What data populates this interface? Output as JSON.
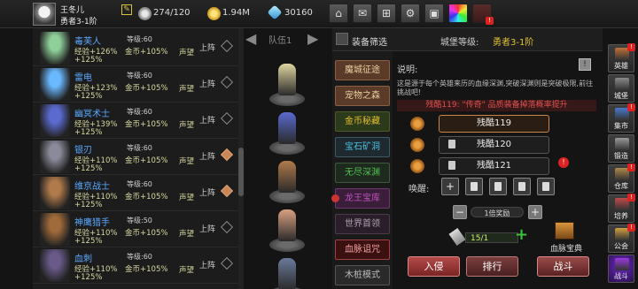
{
  "player": {
    "name": "王冬儿",
    "rank": "勇者3-1阶",
    "stamina": "274/120",
    "gold": "1.94M",
    "gems": "30160"
  },
  "toolbar": {
    "icons": [
      "shop-icon",
      "mail-icon",
      "gamepad-icon",
      "gear-icon",
      "gift-icon",
      "color-wheel-icon",
      "alert-icon"
    ],
    "badge": "!"
  },
  "heroes": [
    {
      "name": "毒芙人",
      "level": "等级:60",
      "exp": "经验+126%",
      "gold": "金币+105%",
      "extra": "+125%",
      "rep": "声望",
      "deploy": "上阵",
      "deployed": false,
      "color": "#8fcf9a"
    },
    {
      "name": "雷电",
      "level": "等级:60",
      "exp": "经验+123%",
      "gold": "金币+105%",
      "extra": "+125%",
      "rep": "声望",
      "deploy": "上阵",
      "deployed": false,
      "color": "#6ab8ff"
    },
    {
      "name": "幽冥术士",
      "level": "等级:60",
      "exp": "经验+139%",
      "gold": "金币+105%",
      "extra": "+125%",
      "rep": "声望",
      "deploy": "上阵",
      "deployed": false,
      "color": "#5a6acf"
    },
    {
      "name": "银刃",
      "level": "等级:60",
      "exp": "经验+110%",
      "gold": "金币+105%",
      "extra": "+125%",
      "rep": "声望",
      "deploy": "上阵",
      "deployed": true,
      "color": "#8a8a9a"
    },
    {
      "name": "维京战士",
      "level": "等级:60",
      "exp": "经验+110%",
      "gold": "金币+105%",
      "extra": "+125%",
      "rep": "声望",
      "deploy": "上阵",
      "deployed": true,
      "color": "#b07a4a"
    },
    {
      "name": "神鹰猎手",
      "level": "等级:50",
      "exp": "经验+110%",
      "gold": "金币+105%",
      "extra": "+125%",
      "rep": "声望",
      "deploy": "上阵",
      "deployed": false,
      "color": "#a06a3a"
    },
    {
      "name": "血刺",
      "level": "等级:60",
      "exp": "经验+110%",
      "gold": "金币+105%",
      "extra": "+125%",
      "rep": "声望",
      "deploy": "上阵",
      "deployed": false,
      "color": "#6a5a8a"
    }
  ],
  "team": {
    "label": "队伍1",
    "slots": [
      {
        "color": "#e0d6a0"
      },
      {
        "color": "#5a6acf"
      },
      {
        "color": "#b07a4a"
      },
      {
        "color": "#d9a080"
      },
      {
        "color": "#6a7a9a"
      }
    ]
  },
  "filter": {
    "title": "装备筛选",
    "castle_level_label": "城堡等级:",
    "castle_level_value": "勇者3-1阶"
  },
  "modes": [
    {
      "label": "魔城征途",
      "bg": "#5a3a28",
      "fg": "#e8d0a0",
      "border": "#8a6040",
      "alert": false
    },
    {
      "label": "宠物之森",
      "bg": "#5a3a28",
      "fg": "#e8d0a0",
      "border": "#8a6040",
      "alert": false
    },
    {
      "label": "金币秘藏",
      "bg": "#2a3a1a",
      "fg": "#e8c030",
      "border": "#4a5a2a",
      "alert": false
    },
    {
      "label": "宝石矿洞",
      "bg": "#1e2a30",
      "fg": "#4ac0e0",
      "border": "#3a5a6a",
      "alert": false
    },
    {
      "label": "无尽深渊",
      "bg": "#1e2a1e",
      "fg": "#50c050",
      "border": "#3a5a3a",
      "alert": false
    },
    {
      "label": "龙王宝库",
      "bg": "#3a1e3a",
      "fg": "#c050c0",
      "border": "#6a3a6a",
      "alert": true
    },
    {
      "label": "世界首领",
      "bg": "#2a1e2a",
      "fg": "#b0a0b0",
      "border": "#4a3a4a",
      "alert": false
    },
    {
      "label": "血脉诅咒",
      "bg": "#3a1010",
      "fg": "#f0a0a0",
      "border": "#a04040",
      "alert": false
    },
    {
      "label": "木桩模式",
      "bg": "#2a2a2a",
      "fg": "#bbbbbb",
      "border": "#555555",
      "alert": false
    }
  ],
  "detail": {
    "desc_title": "说明:",
    "desc_text": "这是源于每个英雄来历的血缘深渊,突破深渊则是突破极限,前往挑战吧!",
    "chest_banner": "残酷119: \"传奇\" 品质装备掉落概率提升",
    "difficulties": [
      {
        "label": "残酷119",
        "locked": false,
        "selected": true
      },
      {
        "label": "残酷120",
        "locked": true,
        "selected": false
      },
      {
        "label": "残酷121",
        "locked": true,
        "selected": false
      }
    ],
    "warn": "!",
    "wake_label": "唤醒:",
    "wake_slots": [
      {
        "type": "plus",
        "glyph": "+"
      },
      {
        "type": "lock",
        "glyph": ""
      },
      {
        "type": "lock",
        "glyph": ""
      },
      {
        "type": "lock",
        "glyph": ""
      },
      {
        "type": "lock",
        "glyph": ""
      }
    ],
    "multiplier_text": "1倍奖励",
    "minus": "−",
    "plus": "+",
    "tickets": "15/1",
    "ticket_plus": "+",
    "chest_label": "血脉宝典",
    "invade": "入侵",
    "rank": "排行",
    "fight": "战斗"
  },
  "sidebar": [
    {
      "label": "英雄",
      "color": "#c0703a",
      "alert": true
    },
    {
      "label": "城堡",
      "color": "#8a8a8a",
      "alert": false
    },
    {
      "label": "集市",
      "color": "#4a7acf",
      "alert": true
    },
    {
      "label": "锻造",
      "color": "#9a9a9a",
      "alert": false
    },
    {
      "label": "仓库",
      "color": "#b08a4a",
      "alert": true
    },
    {
      "label": "培养",
      "color": "#c04a4a",
      "alert": true
    },
    {
      "label": "公会",
      "color": "#d0a040",
      "alert": true
    },
    {
      "label": "战斗",
      "color": "#9a3adf",
      "alert": false
    }
  ]
}
